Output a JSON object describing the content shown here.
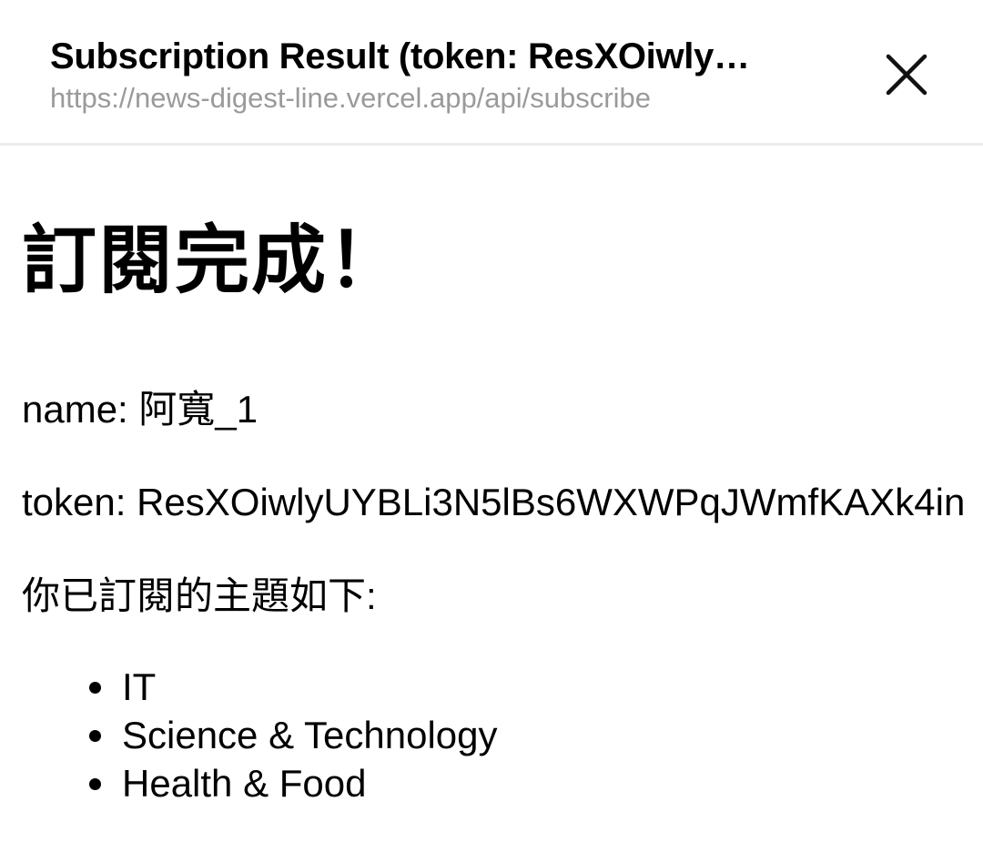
{
  "header": {
    "title": "Subscription Result (token: ResXOiwly…",
    "url": "https://news-digest-line.vercel.app/api/subscribe",
    "close_icon": "close-icon"
  },
  "main": {
    "heading": "訂閱完成！",
    "name_line": "name: 阿寬_1",
    "token_line": "token: ResXOiwlyUYBLi3N5lBs6WXWPqJWmfKAXk4in",
    "topics_label": "你已訂閱的主題如下:",
    "topics": [
      "IT",
      "Science & Technology",
      "Health & Food"
    ]
  }
}
